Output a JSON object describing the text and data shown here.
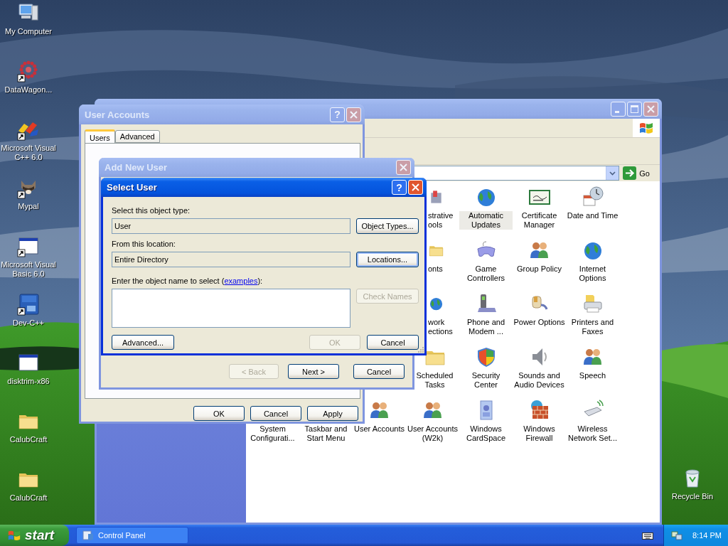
{
  "desktop_icons": [
    {
      "label": "My Computer",
      "shortcut": false
    },
    {
      "label": "DataWagon...",
      "shortcut": true
    },
    {
      "label": "Microsoft Visual C++ 6.0",
      "shortcut": true
    },
    {
      "label": "Mypal",
      "shortcut": true
    },
    {
      "label": "Microsoft Visual Basic 6.0",
      "shortcut": true
    },
    {
      "label": "Dev-C++",
      "shortcut": true
    },
    {
      "label": "disktrim-x86",
      "shortcut": false
    },
    {
      "label": "CalubCraft",
      "shortcut": false
    },
    {
      "label": "CalubCraft",
      "shortcut": false
    }
  ],
  "recycle_bin": {
    "label": "Recycle Bin"
  },
  "control_panel": {
    "go_button": "Go",
    "rows": [
      [
        "",
        "",
        "",
        {
          "kind": "partial",
          "label": "strative ools",
          "selected": false
        },
        {
          "kind": "item",
          "label": "Automatic Updates",
          "selected": true
        },
        {
          "kind": "item",
          "label": "Certificate Manager",
          "selected": false
        },
        {
          "kind": "item",
          "label": "Date and Time",
          "selected": false
        }
      ],
      [
        "",
        "",
        "",
        {
          "kind": "partial",
          "label": "onts",
          "selected": false
        },
        {
          "kind": "item",
          "label": "Game Controllers",
          "selected": false
        },
        {
          "kind": "item",
          "label": "Group Policy",
          "selected": false
        },
        {
          "kind": "item",
          "label": "Internet Options",
          "selected": false
        }
      ],
      [
        "",
        "",
        "",
        {
          "kind": "partial",
          "label": "work ections",
          "selected": false
        },
        {
          "kind": "item",
          "label": "Phone and Modem ...",
          "selected": false
        },
        {
          "kind": "item",
          "label": "Power Options",
          "selected": false
        },
        {
          "kind": "item",
          "label": "Printers and Faxes",
          "selected": false
        }
      ],
      [
        "",
        "",
        "",
        {
          "kind": "item",
          "label": "Scheduled Tasks",
          "selected": false
        },
        {
          "kind": "item",
          "label": "Security Center",
          "selected": false
        },
        {
          "kind": "item",
          "label": "Sounds and Audio Devices",
          "selected": false
        },
        {
          "kind": "item",
          "label": "Speech",
          "selected": false
        }
      ],
      [
        {
          "kind": "label_only",
          "label": "System Configurati...",
          "selected": false
        },
        {
          "kind": "label_only",
          "label": "Taskbar and Start Menu",
          "selected": false
        },
        {
          "kind": "item",
          "label": "User Accounts",
          "selected": false
        },
        {
          "kind": "item",
          "label": "User Accounts (W2k)",
          "selected": false
        },
        {
          "kind": "item",
          "label": "Windows CardSpace",
          "selected": false
        },
        {
          "kind": "item",
          "label": "Windows Firewall",
          "selected": false
        },
        {
          "kind": "item",
          "label": "Wireless Network Set...",
          "selected": false
        }
      ]
    ]
  },
  "user_accounts": {
    "title": "User Accounts",
    "help": "?",
    "tabs": [
      {
        "label": "Users",
        "selected": true
      },
      {
        "label": "Advanced",
        "selected": false
      }
    ],
    "buttons": [
      {
        "label": "OK",
        "disabled": false
      },
      {
        "label": "Cancel",
        "disabled": false
      },
      {
        "label": "Apply",
        "disabled": false
      }
    ]
  },
  "add_new_user": {
    "title": "Add New User",
    "buttons": [
      {
        "label": "< Back",
        "disabled": true
      },
      {
        "label": "Next >",
        "disabled": false
      },
      {
        "label": "Cancel",
        "disabled": false
      }
    ]
  },
  "select_user": {
    "title": "Select User",
    "help": "?",
    "object_type_label": "Select this object type:",
    "object_type_value": "User",
    "object_types_button": {
      "label": "Object Types...",
      "disabled": false,
      "focused": false
    },
    "location_label": "From this location:",
    "location_value": "Entire Directory",
    "locations_button": {
      "label": "Locations...",
      "disabled": false,
      "focused": true
    },
    "name_label": {
      "before": "Enter the object name to select (",
      "link": "examples",
      "after": "):"
    },
    "check_names_button": {
      "label": "Check Names",
      "disabled": true,
      "focused": false
    },
    "advanced_button": {
      "label": "Advanced...",
      "disabled": false,
      "focused": false
    },
    "ok_button": {
      "label": "OK",
      "disabled": true,
      "focused": false
    },
    "cancel_button": {
      "label": "Cancel",
      "disabled": false,
      "focused": false
    }
  },
  "taskbar": {
    "start": "start",
    "tasks": [
      {
        "label": "Control Panel",
        "selected": false
      }
    ],
    "clock": "8:14 PM"
  }
}
